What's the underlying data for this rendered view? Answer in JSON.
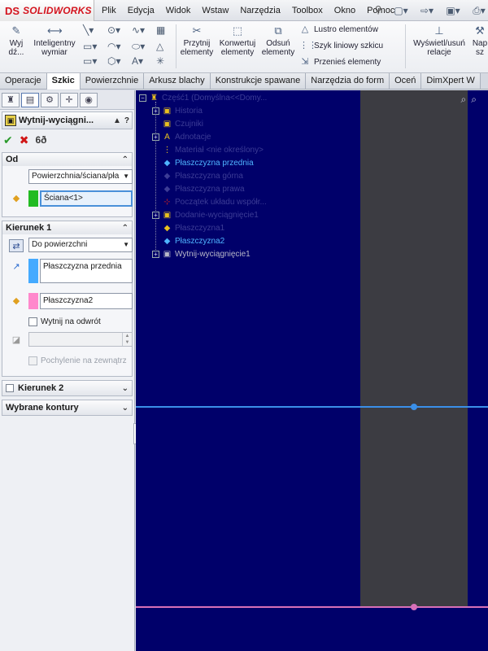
{
  "app": {
    "logo_symbol": "DS",
    "logo_text": "SOLIDWORKS"
  },
  "menu": [
    "Plik",
    "Edycja",
    "Widok",
    "Wstaw",
    "Narzędzia",
    "Toolbox",
    "Okno",
    "Pomoc"
  ],
  "ribbon": {
    "btn_wyjdz": "Wyj dź...",
    "btn_inteligentny": "Inteligentny wymiar",
    "btn_przytnij": "Przytnij elementy",
    "btn_konwertuj": "Konwertuj elementy",
    "btn_odsun": "Odsuń elementy",
    "small_lustro": "Lustro elementów",
    "small_szyk": "Szyk liniowy szkicu",
    "small_przenies": "Przenieś elementy",
    "btn_wyswietl": "Wyświetl/usuń relacje",
    "btn_napr": "Nap sz"
  },
  "tabs": [
    "Operacje",
    "Szkic",
    "Powierzchnie",
    "Arkusz blachy",
    "Konstrukcje spawane",
    "Narzędzia do form",
    "Oceń",
    "DimXpert W"
  ],
  "active_tab": "Szkic",
  "property_manager": {
    "title": "Wytnij-wyciągni...",
    "help": "?",
    "group_od": {
      "label": "Od",
      "select_value": "Powierzchnia/ściana/pła",
      "field_value": "Ściana<1>"
    },
    "group_kierunek1": {
      "label": "Kierunek 1",
      "select_value": "Do powierzchni",
      "field1": "Płaszczyzna przednia",
      "field2": "Płaszczyzna2",
      "check_wytnij": "Wytnij na odwrót",
      "check_pochylenie": "Pochylenie na zewnątrz"
    },
    "group_kierunek2": {
      "label": "Kierunek 2"
    },
    "group_wybrane": {
      "label": "Wybrane kontury"
    }
  },
  "tree": {
    "items": [
      {
        "label": "Część1 (Domyślna<<Domy...",
        "style": "dim"
      },
      {
        "label": "Historia",
        "style": "dim"
      },
      {
        "label": "Czujniki",
        "style": "dim"
      },
      {
        "label": "Adnotacje",
        "style": "dim"
      },
      {
        "label": "Materiał <nie określony>",
        "style": "dim"
      },
      {
        "label": "Płaszczyzna przednia",
        "style": "blue"
      },
      {
        "label": "Płaszczyzna górna",
        "style": "dim"
      },
      {
        "label": "Płaszczyzna prawa",
        "style": "dim"
      },
      {
        "label": "Początek układu współr...",
        "style": "dim"
      },
      {
        "label": "Dodanie-wyciągnięcie1",
        "style": "dim"
      },
      {
        "label": "Płaszczyzna1",
        "style": "dim"
      },
      {
        "label": "Płaszczyzna2",
        "style": "blue"
      },
      {
        "label": "Wytnij-wyciągnięcie1",
        "style": "gray"
      }
    ]
  },
  "colors": {
    "viewport_bg": "#00006a",
    "face_gray": "#3c3c42",
    "line_blue": "#3a8fe8",
    "line_pink": "#d870b8",
    "field_green": "#22bb22",
    "field_blue": "#44aaff",
    "field_pink": "#ff88cc"
  }
}
